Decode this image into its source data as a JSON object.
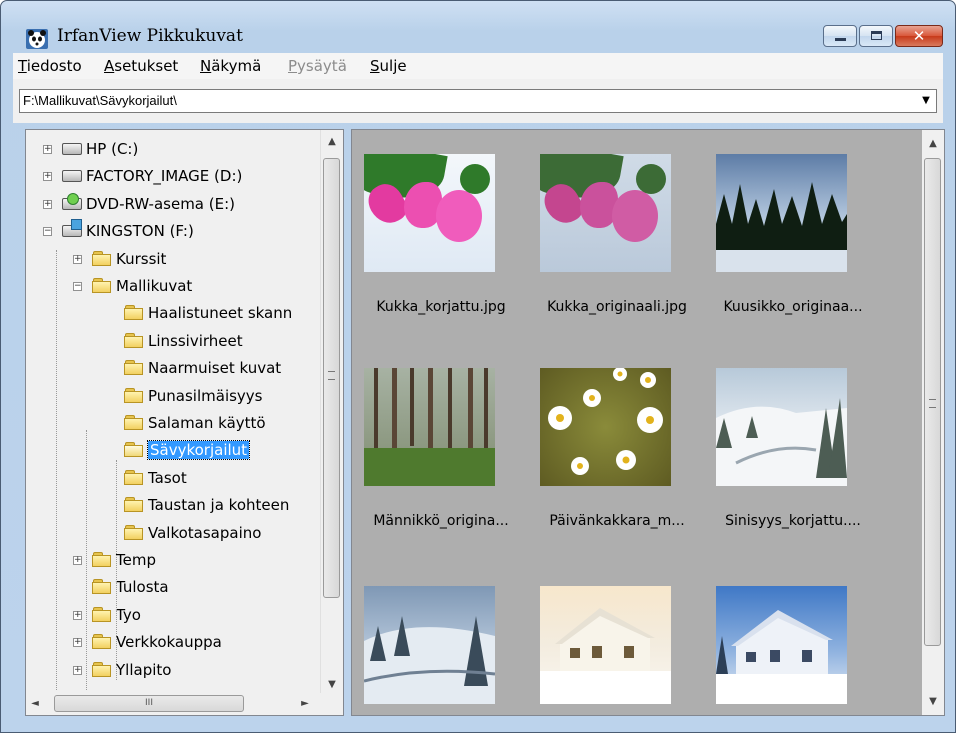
{
  "window": {
    "title": "IrfanView Pikkukuvat",
    "buttons": {
      "minimize": "minimize",
      "maximize": "maximize",
      "close": "close"
    }
  },
  "menu": [
    {
      "label": "Tiedosto",
      "mnemonic": "T",
      "rest": "iedosto",
      "enabled": true
    },
    {
      "label": "Asetukset",
      "mnemonic": "A",
      "rest": "setukset",
      "enabled": true
    },
    {
      "label": "Näkymä",
      "mnemonic": "N",
      "rest": "äkymä",
      "enabled": true
    },
    {
      "label": "Pysäytä",
      "mnemonic": "P",
      "rest": "ysäytä",
      "enabled": false
    },
    {
      "label": "Sulje",
      "mnemonic": "S",
      "rest": "ulje",
      "enabled": true
    }
  ],
  "path": "F:\\Mallikuvat\\Sävykorjailut\\",
  "tree": {
    "items": [
      {
        "label": "HP (C:)",
        "type": "drive",
        "expander": "+"
      },
      {
        "label": "FACTORY_IMAGE (D:)",
        "type": "drive",
        "expander": "+"
      },
      {
        "label": "DVD-RW-asema (E:)",
        "type": "dvd",
        "expander": "+"
      },
      {
        "label": "KINGSTON (F:)",
        "type": "usb",
        "expander": "−"
      },
      {
        "label": "Kurssit",
        "type": "folder",
        "expander": "+"
      },
      {
        "label": "Mallikuvat",
        "type": "folder",
        "expander": "−"
      },
      {
        "label": "Haalistuneet skann",
        "type": "folder",
        "expander": ""
      },
      {
        "label": "Linssivirheet",
        "type": "folder",
        "expander": ""
      },
      {
        "label": "Naarmuiset kuvat",
        "type": "folder",
        "expander": ""
      },
      {
        "label": "Punasilmäisyys",
        "type": "folder",
        "expander": ""
      },
      {
        "label": "Salaman käyttö",
        "type": "folder",
        "expander": ""
      },
      {
        "label": "Sävykorjailut",
        "type": "folder-open",
        "expander": "",
        "selected": true
      },
      {
        "label": "Tasot",
        "type": "folder",
        "expander": ""
      },
      {
        "label": "Taustan ja kohteen",
        "type": "folder",
        "expander": ""
      },
      {
        "label": "Valkotasapaino",
        "type": "folder",
        "expander": ""
      },
      {
        "label": "Temp",
        "type": "folder",
        "expander": "+"
      },
      {
        "label": "Tulosta",
        "type": "folder",
        "expander": ""
      },
      {
        "label": "Tyo",
        "type": "folder",
        "expander": "+"
      },
      {
        "label": "Verkkokauppa",
        "type": "folder",
        "expander": "+"
      },
      {
        "label": "Yllapito",
        "type": "folder",
        "expander": "+"
      }
    ],
    "hscroll_thumb": "III"
  },
  "thumbnails": [
    {
      "caption": "Kukka_korjattu.jpg",
      "scene": "flower-pink"
    },
    {
      "caption": "Kukka_originaali.jpg",
      "scene": "flower-pink-dull"
    },
    {
      "caption": "Kuusikko_originaa...",
      "scene": "spruce-forest"
    },
    {
      "caption": "Männikkö_origina...",
      "scene": "pine-forest"
    },
    {
      "caption": "Päivänkakkara_m...",
      "scene": "daisies"
    },
    {
      "caption": "Sinisyys_korjattu....",
      "scene": "snowy-valley"
    },
    {
      "caption": "",
      "scene": "snowy-hill-blue"
    },
    {
      "caption": "",
      "scene": "house-snow-warm"
    },
    {
      "caption": "",
      "scene": "house-snow-blue"
    }
  ]
}
